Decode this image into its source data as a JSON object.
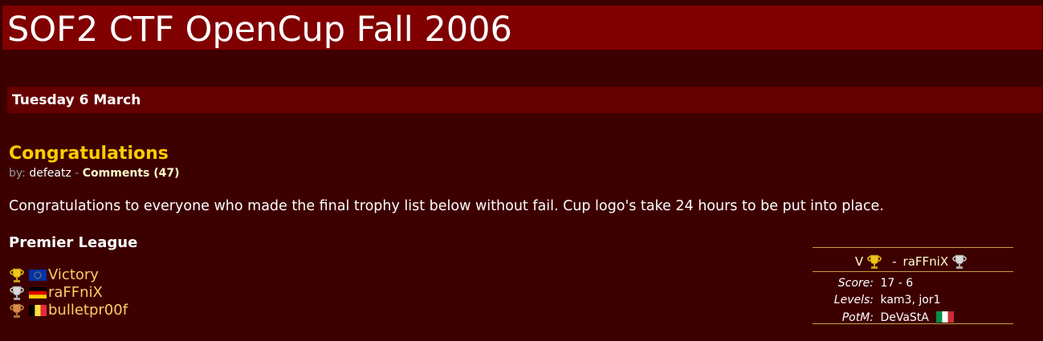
{
  "site": {
    "title": "SOF2 CTF OpenCup Fall 2006"
  },
  "date_header": "Tuesday 6 March",
  "news": {
    "title": "Congratulations",
    "by_label": "by:",
    "author": "defeatz",
    "separator": "-",
    "comments_label": "Comments (47)",
    "body": "Congratulations to everyone who made the final trophy list below without fail. Cup logo's take 24 hours to be put into place."
  },
  "league": {
    "title": "Premier League",
    "trophies": [
      {
        "cup": "gold-trophy-icon",
        "flag": "eu-flag-icon",
        "team": "Victory"
      },
      {
        "cup": "silver-trophy-icon",
        "flag": "germany-flag-icon",
        "team": "raFFniX"
      },
      {
        "cup": "bronze-trophy-icon",
        "flag": "belgium-flag-icon",
        "team": "bulletpr00f"
      }
    ]
  },
  "match": {
    "team_a": "V",
    "dash": "-",
    "team_b": "raFFniX",
    "score_label": "Score:",
    "score": "17 - 6",
    "levels_label": "Levels:",
    "levels": "kam3, jor1",
    "potm_label": "PotM:",
    "potm": "DeVaStA",
    "potm_flag": "italy-flag-icon"
  },
  "colors": {
    "background": "#3d0000",
    "header": "#800000",
    "date_bar": "#650000",
    "accent": "#ffcc00",
    "team_text": "#ffcc66",
    "rule": "#c9a040"
  }
}
